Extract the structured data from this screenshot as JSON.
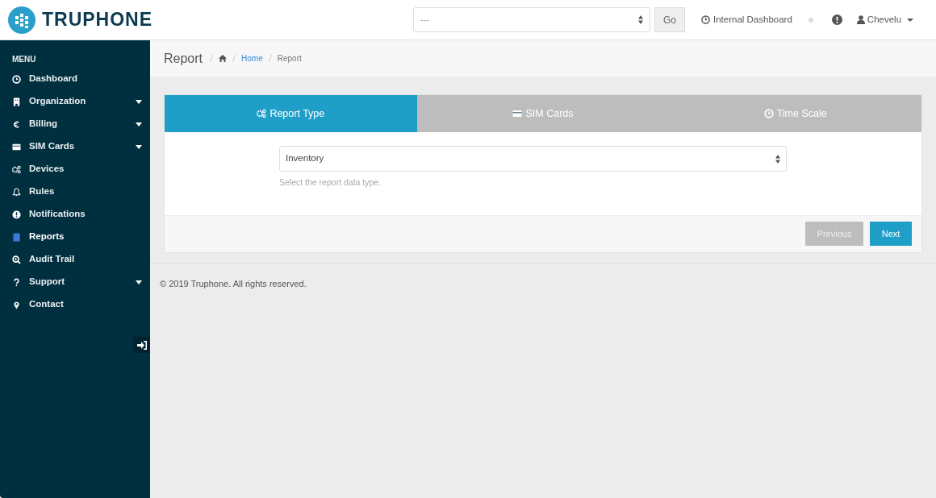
{
  "brand": {
    "name": "TRUPHONE"
  },
  "topbar": {
    "account_select": {
      "value": "---"
    },
    "go_button": "Go",
    "internal_dashboard": "Internal Dashboard",
    "user": "Chevelu"
  },
  "sidebar": {
    "heading": "MENU",
    "items": [
      {
        "label": "Dashboard",
        "has_submenu": false,
        "selected": false
      },
      {
        "label": "Organization",
        "has_submenu": true,
        "selected": false
      },
      {
        "label": "Billing",
        "has_submenu": true,
        "selected": false
      },
      {
        "label": "SIM Cards",
        "has_submenu": true,
        "selected": false
      },
      {
        "label": "Devices",
        "has_submenu": false,
        "selected": false
      },
      {
        "label": "Rules",
        "has_submenu": false,
        "selected": false
      },
      {
        "label": "Notifications",
        "has_submenu": false,
        "selected": false
      },
      {
        "label": "Reports",
        "has_submenu": false,
        "selected": true
      },
      {
        "label": "Audit Trail",
        "has_submenu": false,
        "selected": false
      },
      {
        "label": "Support",
        "has_submenu": true,
        "selected": false
      },
      {
        "label": "Contact",
        "has_submenu": false,
        "selected": false
      }
    ]
  },
  "page": {
    "title": "Report",
    "breadcrumbs": [
      {
        "label": "Home",
        "link": true
      },
      {
        "label": "Report",
        "link": false
      }
    ]
  },
  "wizard": {
    "tabs": [
      {
        "label": "Report Type",
        "selected": true
      },
      {
        "label": "SIM Cards",
        "selected": false
      },
      {
        "label": "Time Scale",
        "selected": false
      }
    ],
    "report_type_select": {
      "value": "Inventory"
    },
    "help": "Select the report data type.",
    "buttons": [
      {
        "label": "Previous",
        "disabled": true
      },
      {
        "label": "Next",
        "disabled": false
      }
    ]
  },
  "footer": "© 2019 Truphone. All rights reserved."
}
